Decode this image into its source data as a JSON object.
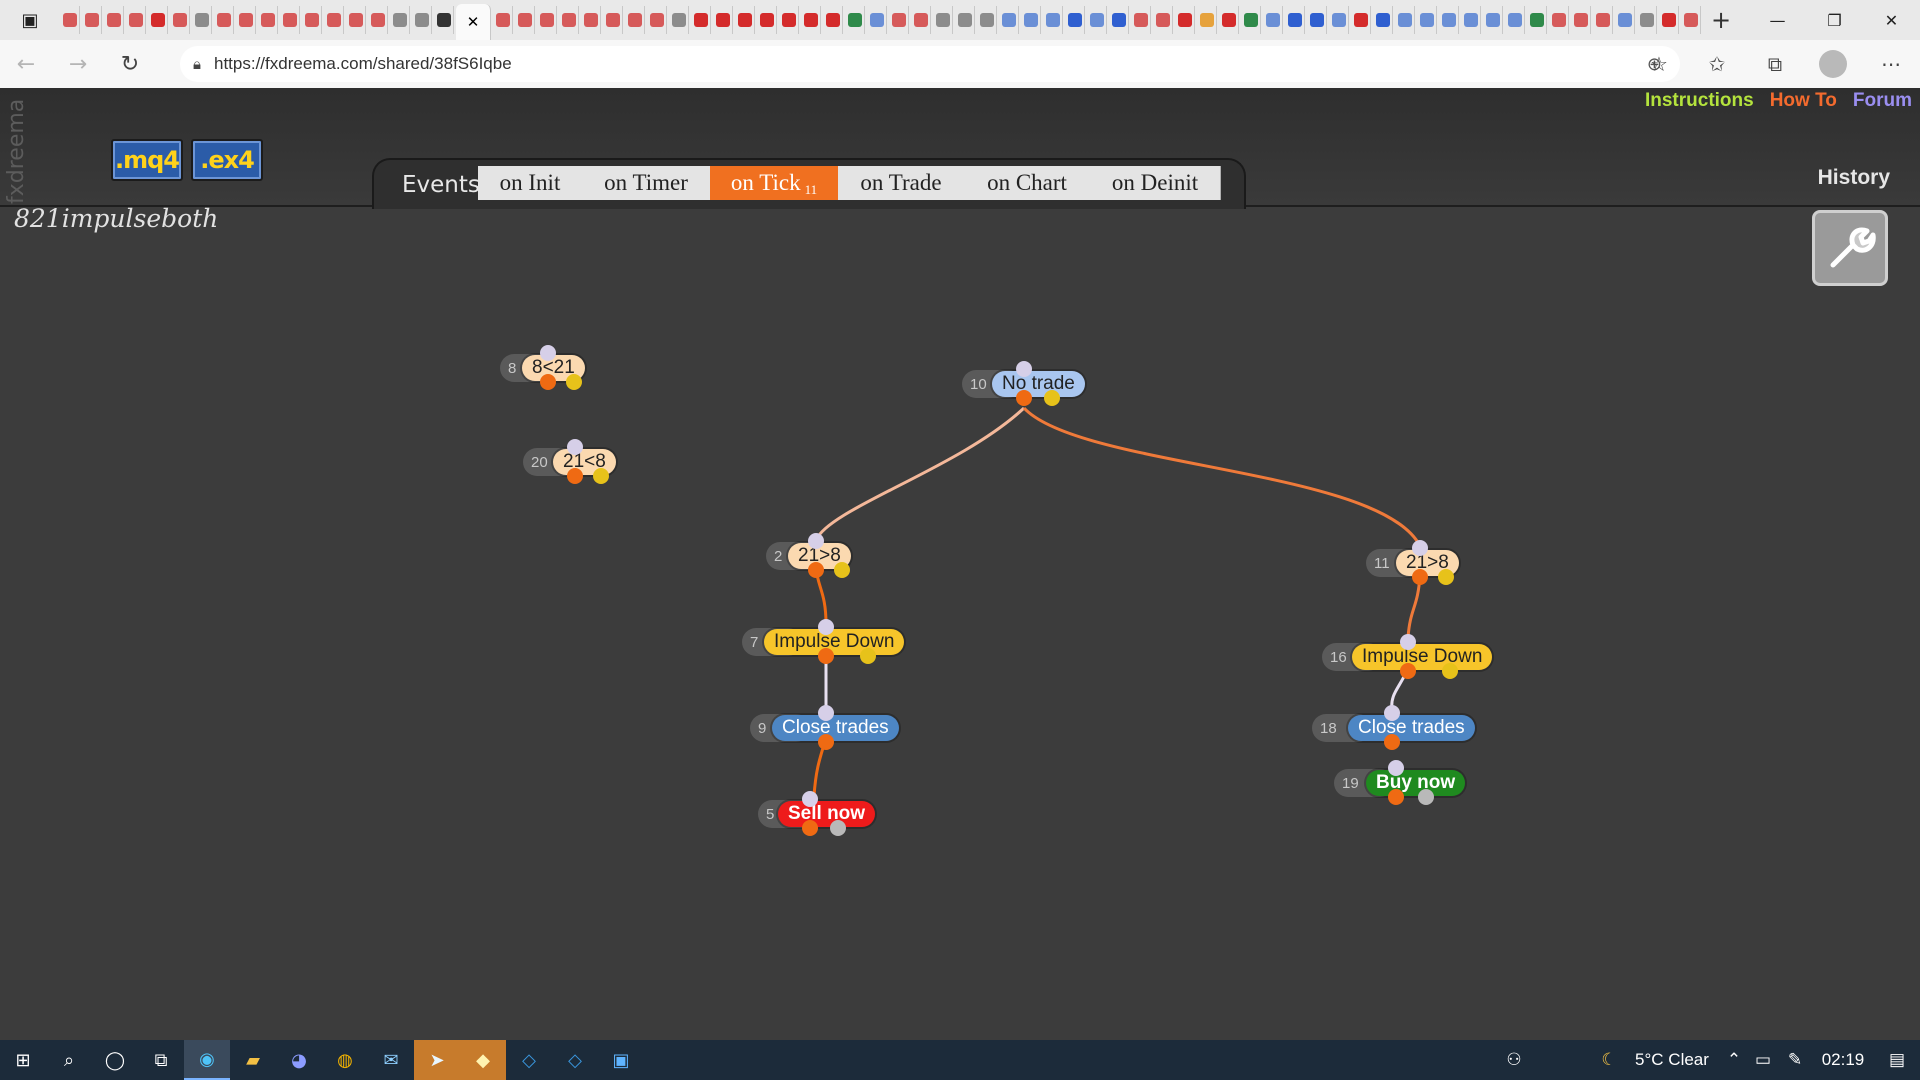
{
  "browser": {
    "tab_colors": [
      "#d65a5a",
      "#d65a5a",
      "#d65a5a",
      "#d65a5a",
      "#d42b2b",
      "#d65a5a",
      "#8c8c8c",
      "#d65a5a",
      "#d65a5a",
      "#d65a5a",
      "#d65a5a",
      "#d65a5a",
      "#d65a5a",
      "#d65a5a",
      "#d65a5a",
      "#8c8c8c",
      "#8c8c8c",
      "#333333",
      "#d65a5a",
      "#d65a5a",
      "#d65a5a",
      "#d65a5a",
      "#d65a5a",
      "#d65a5a",
      "#d65a5a",
      "#d65a5a",
      "#8c8c8c",
      "#d42b2b",
      "#d42b2b",
      "#d42b2b",
      "#d42b2b",
      "#d42b2b",
      "#d42b2b",
      "#d42b2b",
      "#2f8a4a",
      "#6a8fd6",
      "#d65a5a",
      "#d65a5a",
      "#8c8c8c",
      "#8c8c8c",
      "#8c8c8c",
      "#6a8fd6",
      "#6a8fd6",
      "#6a8fd6",
      "#2f5fd0",
      "#6a8fd6",
      "#2f5fd0",
      "#d65a5a",
      "#d65a5a",
      "#d42b2b",
      "#e6a23c",
      "#d42b2b",
      "#2f8a4a",
      "#6a8fd6",
      "#2f5fd0",
      "#2f5fd0",
      "#6a8fd6",
      "#d42b2b",
      "#2f5fd0",
      "#6a8fd6",
      "#6a8fd6",
      "#6a8fd6",
      "#6a8fd6",
      "#6a8fd6",
      "#6a8fd6",
      "#2f8a4a",
      "#d65a5a",
      "#d65a5a",
      "#d65a5a",
      "#6a8fd6",
      "#8c8c8c",
      "#d42b2b",
      "#d65a5a"
    ],
    "active_tab_close": "✕",
    "new_tab": "+",
    "url": "https://fxdreema.com/shared/38fS6Iqbe"
  },
  "app": {
    "logo_text": "fxdreema",
    "buttons": {
      "mq4": ".mq4",
      "ex4": ".ex4"
    },
    "links": [
      {
        "label": "Instructions",
        "color": "#b4e33d"
      },
      {
        "label": "How To",
        "color": "#f46b2e"
      },
      {
        "label": "Forum",
        "color": "#9a8ef0"
      }
    ],
    "history": "History",
    "events_label": "Events",
    "event_tabs": [
      {
        "label": "on Init",
        "badge": ""
      },
      {
        "label": "on Timer",
        "badge": ""
      },
      {
        "label": "on Tick",
        "badge": "11"
      },
      {
        "label": "on Trade",
        "badge": ""
      },
      {
        "label": "on Chart",
        "badge": ""
      },
      {
        "label": "on Deinit",
        "badge": ""
      }
    ],
    "active_tab": "on Tick",
    "project_name": "821impulseboth"
  },
  "blocks": [
    {
      "id": "8",
      "label": "8<21",
      "bg": "#fbd9b0",
      "fg": "#222222"
    },
    {
      "id": "20",
      "label": "21<8",
      "bg": "#fbd9b0",
      "fg": "#222222"
    },
    {
      "id": "10",
      "label": "No trade",
      "bg": "#a9c6ef",
      "fg": "#222222"
    },
    {
      "id": "2",
      "label": "21>8",
      "bg": "#fbd9b0",
      "fg": "#222222"
    },
    {
      "id": "11",
      "label": "21>8",
      "bg": "#fbd9b0",
      "fg": "#222222"
    },
    {
      "id": "7",
      "label": "Impulse Down",
      "bg": "#f7c52a",
      "fg": "#222222"
    },
    {
      "id": "16",
      "label": "Impulse Down",
      "bg": "#f7c52a",
      "fg": "#222222"
    },
    {
      "id": "9",
      "label": "Close trades",
      "bg": "#4d86c4",
      "fg": "#ffffff"
    },
    {
      "id": "18",
      "label": "Close trades",
      "bg": "#4d86c4",
      "fg": "#ffffff"
    },
    {
      "id": "5",
      "label": "Sell now",
      "bg": "#ee1b1b",
      "fg": "#ffffff"
    },
    {
      "id": "19",
      "label": "Buy now",
      "bg": "#1f8a1f",
      "fg": "#ffffff"
    }
  ],
  "taskbar": {
    "weather": "5°C  Clear",
    "time": "02:19"
  }
}
